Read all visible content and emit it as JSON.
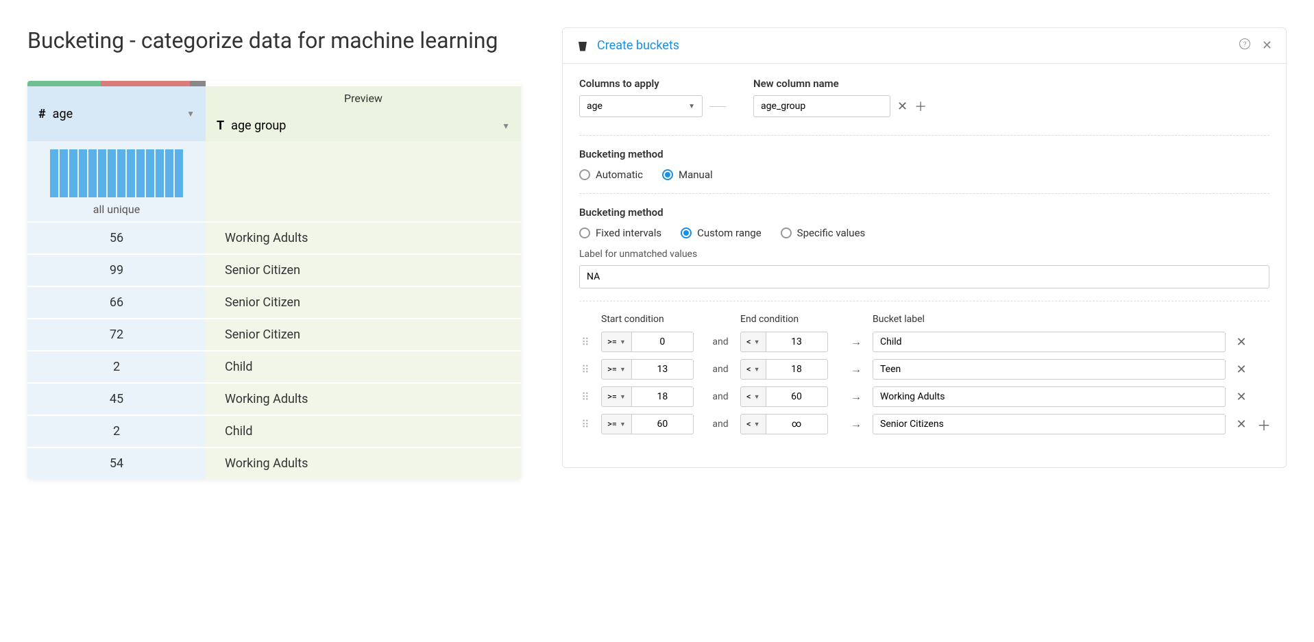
{
  "page_title": "Bucketing - categorize data for machine learning",
  "table": {
    "preview_label": "Preview",
    "columns": {
      "age": {
        "name": "age",
        "hist_label": "all unique"
      },
      "group": {
        "name": "age group"
      }
    },
    "rows": [
      {
        "age": "56",
        "group": "Working Adults"
      },
      {
        "age": "99",
        "group": "Senior Citizen"
      },
      {
        "age": "66",
        "group": "Senior Citizen"
      },
      {
        "age": "72",
        "group": "Senior Citizen"
      },
      {
        "age": "2",
        "group": "Child"
      },
      {
        "age": "45",
        "group": "Working Adults"
      },
      {
        "age": "2",
        "group": "Child"
      },
      {
        "age": "54",
        "group": "Working Adults"
      }
    ]
  },
  "panel": {
    "title": "Create buckets",
    "columns_to_apply_label": "Columns to apply",
    "columns_to_apply_value": "age",
    "new_column_label": "New column name",
    "new_column_value": "age_group",
    "bucketing_method_label": "Bucketing method",
    "method_options": {
      "automatic": "Automatic",
      "manual": "Manual"
    },
    "range_label": "Bucketing method",
    "range_options": {
      "fixed": "Fixed intervals",
      "custom": "Custom range",
      "specific": "Specific values"
    },
    "unmatched_label": "Label for unmatched values",
    "unmatched_value": "NA",
    "bucket_headers": {
      "start": "Start condition",
      "end": "End condition",
      "label": "Bucket label"
    },
    "and_text": "and",
    "buckets": [
      {
        "start_op": ">=",
        "start_val": "0",
        "end_op": "<",
        "end_val": "13",
        "label": "Child"
      },
      {
        "start_op": ">=",
        "start_val": "13",
        "end_op": "<",
        "end_val": "18",
        "label": "Teen"
      },
      {
        "start_op": ">=",
        "start_val": "18",
        "end_op": "<",
        "end_val": "60",
        "label": "Working Adults"
      },
      {
        "start_op": ">=",
        "start_val": "60",
        "end_op": "<",
        "end_val": "∞",
        "label": "Senior Citizens"
      }
    ]
  }
}
